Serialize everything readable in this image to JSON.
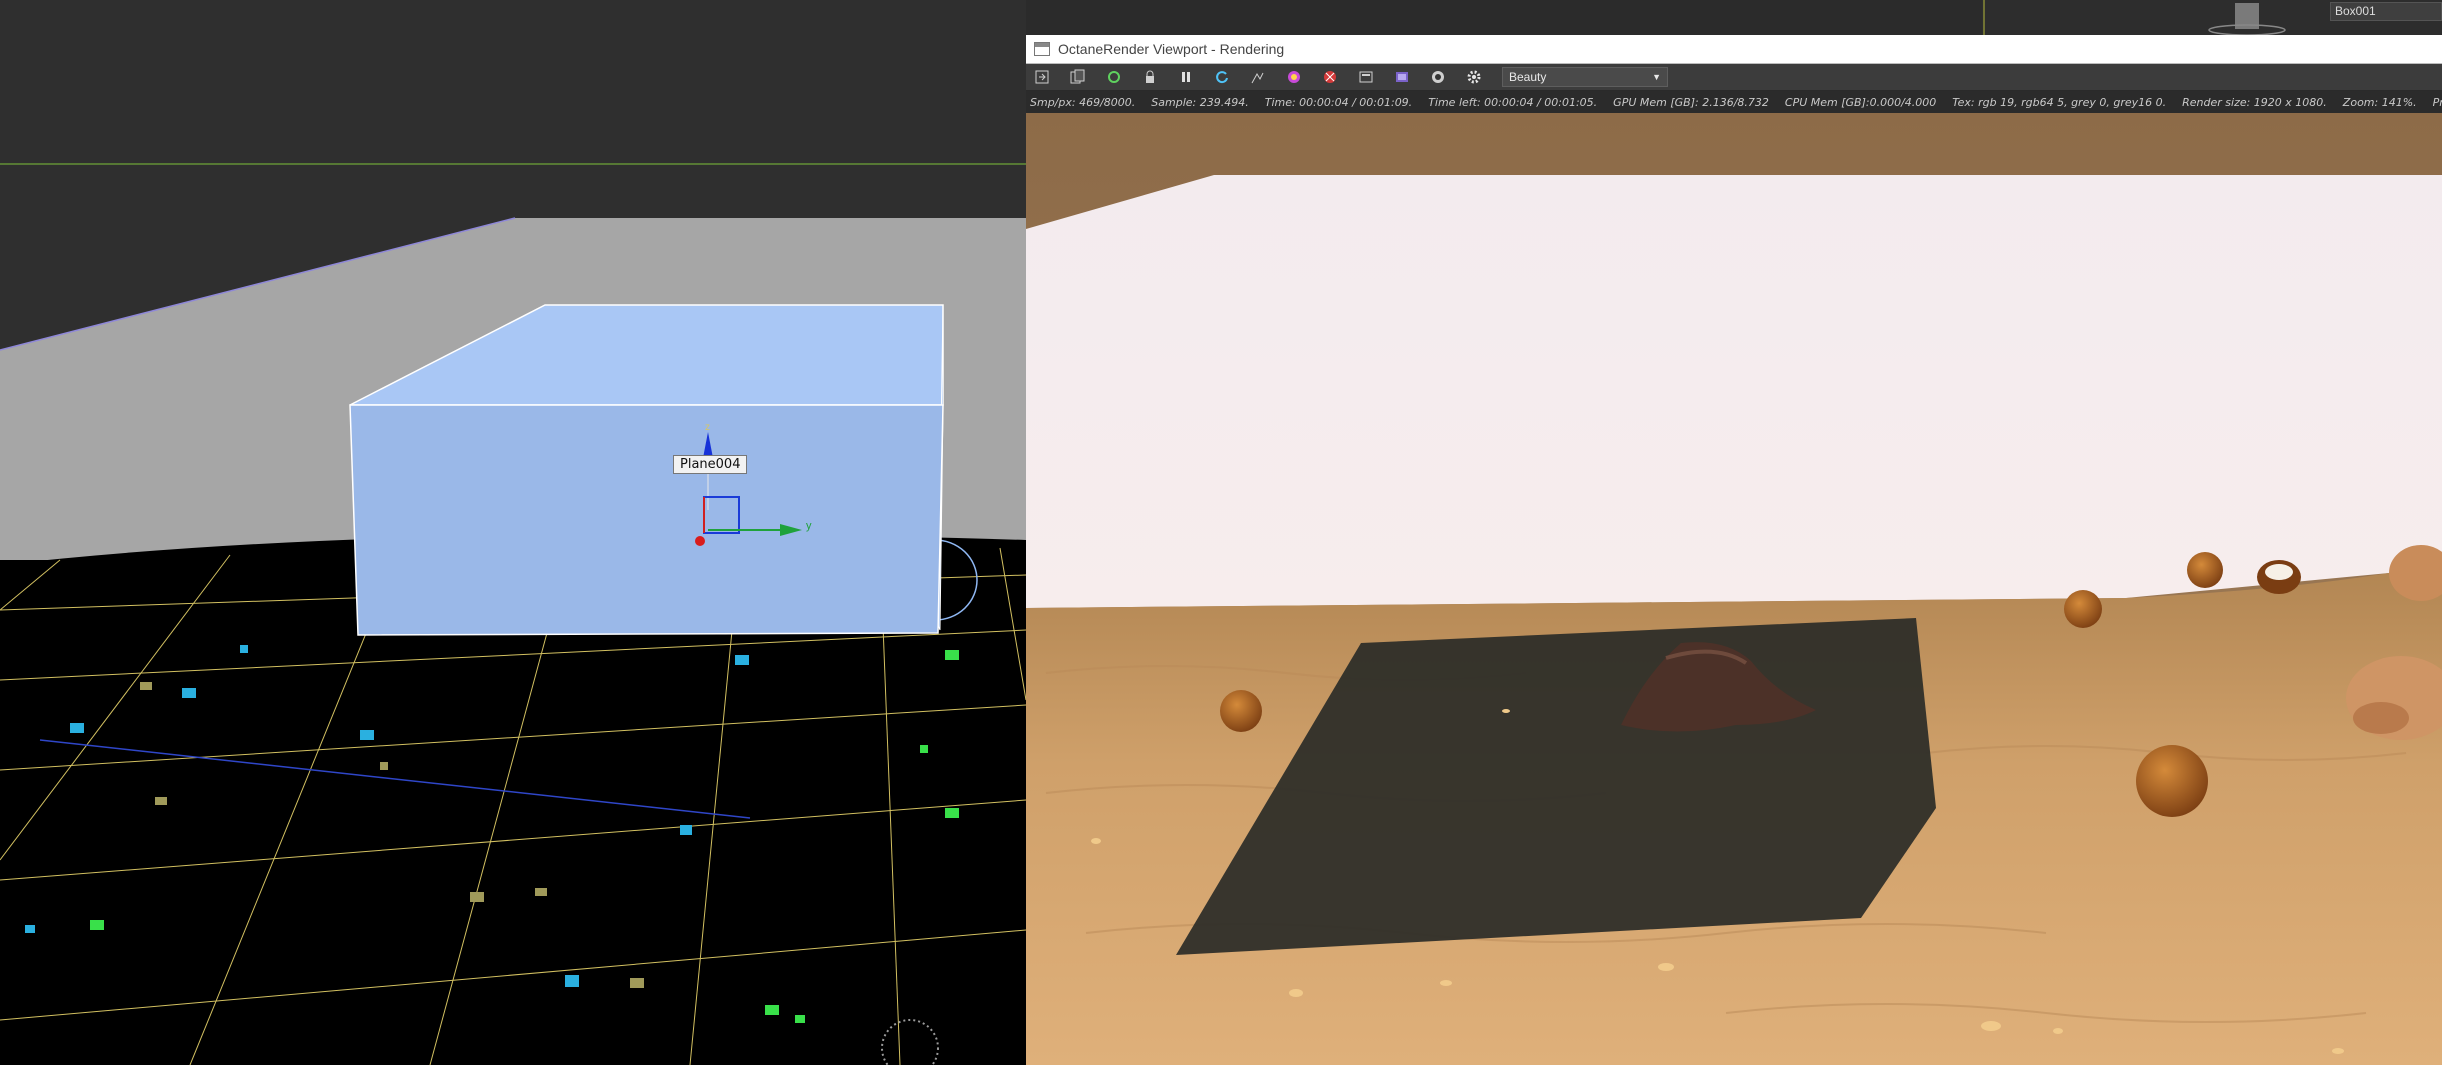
{
  "viewport_3ds": {
    "object_label": "Plane004",
    "gizmo_y_label": "y",
    "gizmo_z_label": "z"
  },
  "octane_window": {
    "title": "OctaneRender Viewport - Rendering",
    "render_pass": "Beauty",
    "toolbar_icons": [
      "export-icon",
      "copy-icon",
      "restart-icon",
      "lock-icon",
      "pause-icon",
      "refresh-icon",
      "focus-picker-icon",
      "color-picker-icon",
      "material-picker-icon",
      "region-icon",
      "film-region-icon",
      "camera-icon",
      "settings-gear-icon"
    ],
    "status": {
      "samples_px": "Smp/px: 469/8000.",
      "samples_rate": "Sample: 239.494.",
      "time": "Time: 00:00:04 / 00:01:09.",
      "time_left": "Time left: 00:00:04 / 00:01:05.",
      "gpu_mem": "GPU Mem [GB]: 2.136/8.732",
      "cpu_mem": "CPU Mem [GB]:0.000/4.000",
      "tex": "Tex: rgb 19, rgb64 5, grey 0, grey16 0.",
      "render_size": "Render size: 1920 x 1080.",
      "zoom": "Zoom: 141%.",
      "primitives": "Primitives/Meshes/Voxels: 2765289/8896/0"
    }
  },
  "right_panel": {
    "object_name": "Box001"
  }
}
